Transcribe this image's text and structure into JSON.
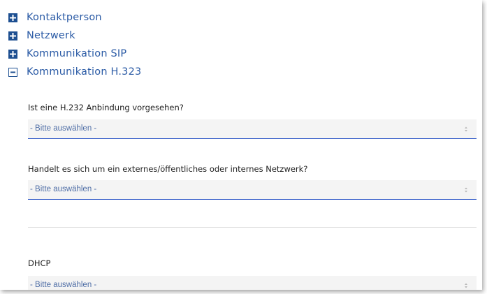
{
  "accordion": {
    "items": [
      {
        "label": "Kontaktperson",
        "state": "collapsed"
      },
      {
        "label": "Netzwerk",
        "state": "collapsed"
      },
      {
        "label": "Kommunikation SIP",
        "state": "collapsed"
      },
      {
        "label": "Kommunikation H.323",
        "state": "expanded"
      }
    ]
  },
  "form": {
    "q1": {
      "label": "Ist eine H.232 Anbindung vorgesehen?",
      "value": "- Bitte auswählen -"
    },
    "q2": {
      "label": "Handelt es sich um ein externes/öffentliches oder internes Netzwerk?",
      "value": "- Bitte auswählen -"
    },
    "q3": {
      "label": "DHCP",
      "value": "- Bitte auswählen -"
    }
  },
  "colors": {
    "accent": "#2a5aa5",
    "icon": "#1d4f91",
    "select_underline": "#2f58c7",
    "select_bg": "#f4f4f4"
  }
}
